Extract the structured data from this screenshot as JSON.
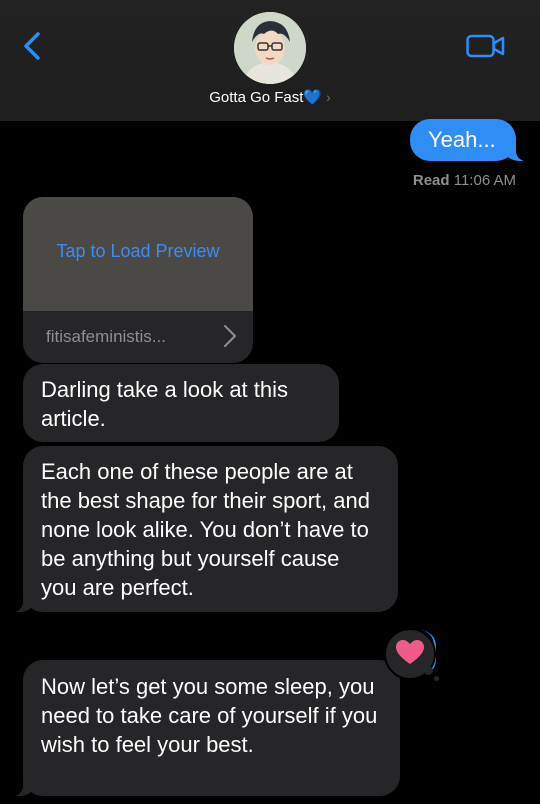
{
  "header": {
    "contact_name": "Gotta Go Fast💙",
    "chevron": "›"
  },
  "messages": {
    "sent_1": "Yeah...",
    "read_receipt_label": "Read",
    "read_receipt_time": "11:06 AM",
    "link_preview_action": "Tap to Load Preview",
    "link_url": "fitisafeministis...",
    "recv_1": "Darling take a look at this article.",
    "recv_2": "Each one of these people are at the best shape for their sport, and none look alike. You don’t have to be anything but yourself cause you are perfect.",
    "recv_3": "Now let’s get you some sleep, you need to take care of yourself if you wish to feel your best."
  },
  "tapback": {
    "icon": "heart-icon",
    "color": "#f05c8a"
  },
  "colors": {
    "accent": "#2f8ef5",
    "received_bubble": "#262628",
    "background": "#000000"
  }
}
